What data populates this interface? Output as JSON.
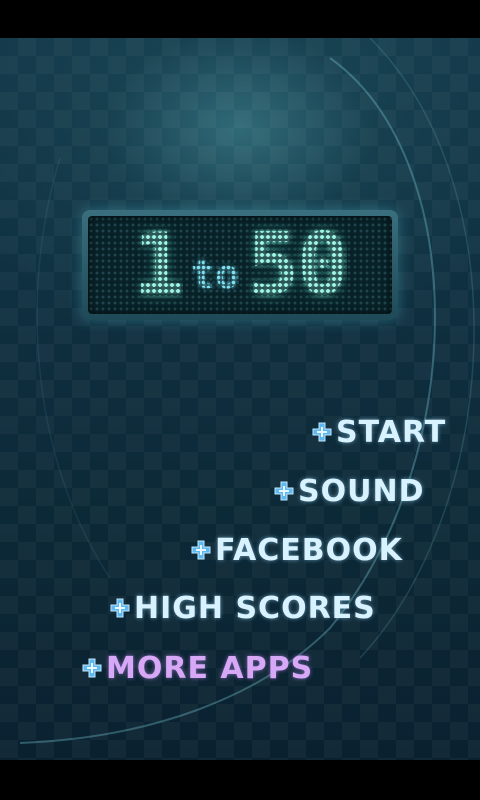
{
  "logo": {
    "number_one": "1",
    "connector": "to",
    "number_two": "50"
  },
  "menu": {
    "items": [
      {
        "label": "START",
        "icon": "plus-bullet-icon"
      },
      {
        "label": "SOUND",
        "icon": "plus-bullet-icon"
      },
      {
        "label": "FACEBOOK",
        "icon": "plus-bullet-icon"
      },
      {
        "label": "HIGH SCORES",
        "icon": "plus-bullet-icon"
      },
      {
        "label": "MORE APPS",
        "icon": "plus-bullet-icon"
      }
    ]
  },
  "colors": {
    "background": "#0f3040",
    "menu_text": "#d8f2ff",
    "menu_accent": "#d6a8f5",
    "logo_led": "#9ff7e4",
    "bullet": "#5fb8f0"
  }
}
